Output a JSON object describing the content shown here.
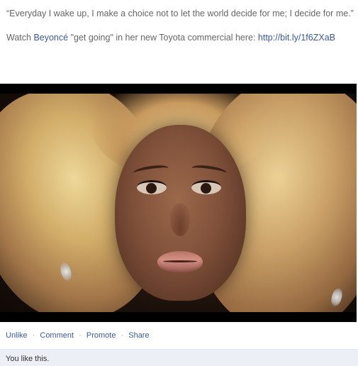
{
  "post": {
    "quote": "“Everyday I wake up, I make a choice not to let the world decide for me; I decide for me.”",
    "watch_prefix": "Watch ",
    "artist_link": "Beyoncé",
    "watch_middle": " \"get going\" in her new Toyota commercial here: ",
    "url": "http://bit.ly/1f6ZXaB"
  },
  "video": {
    "thumbnail_description_icon": "video-thumbnail"
  },
  "actions": {
    "unlike": "Unlike",
    "comment": "Comment",
    "promote": "Promote",
    "share": "Share",
    "separator": "·"
  },
  "likes": {
    "text": "You like this."
  },
  "colors": {
    "link": "#3b5998",
    "text_muted": "#666666",
    "likes_bg": "#eceff5"
  }
}
